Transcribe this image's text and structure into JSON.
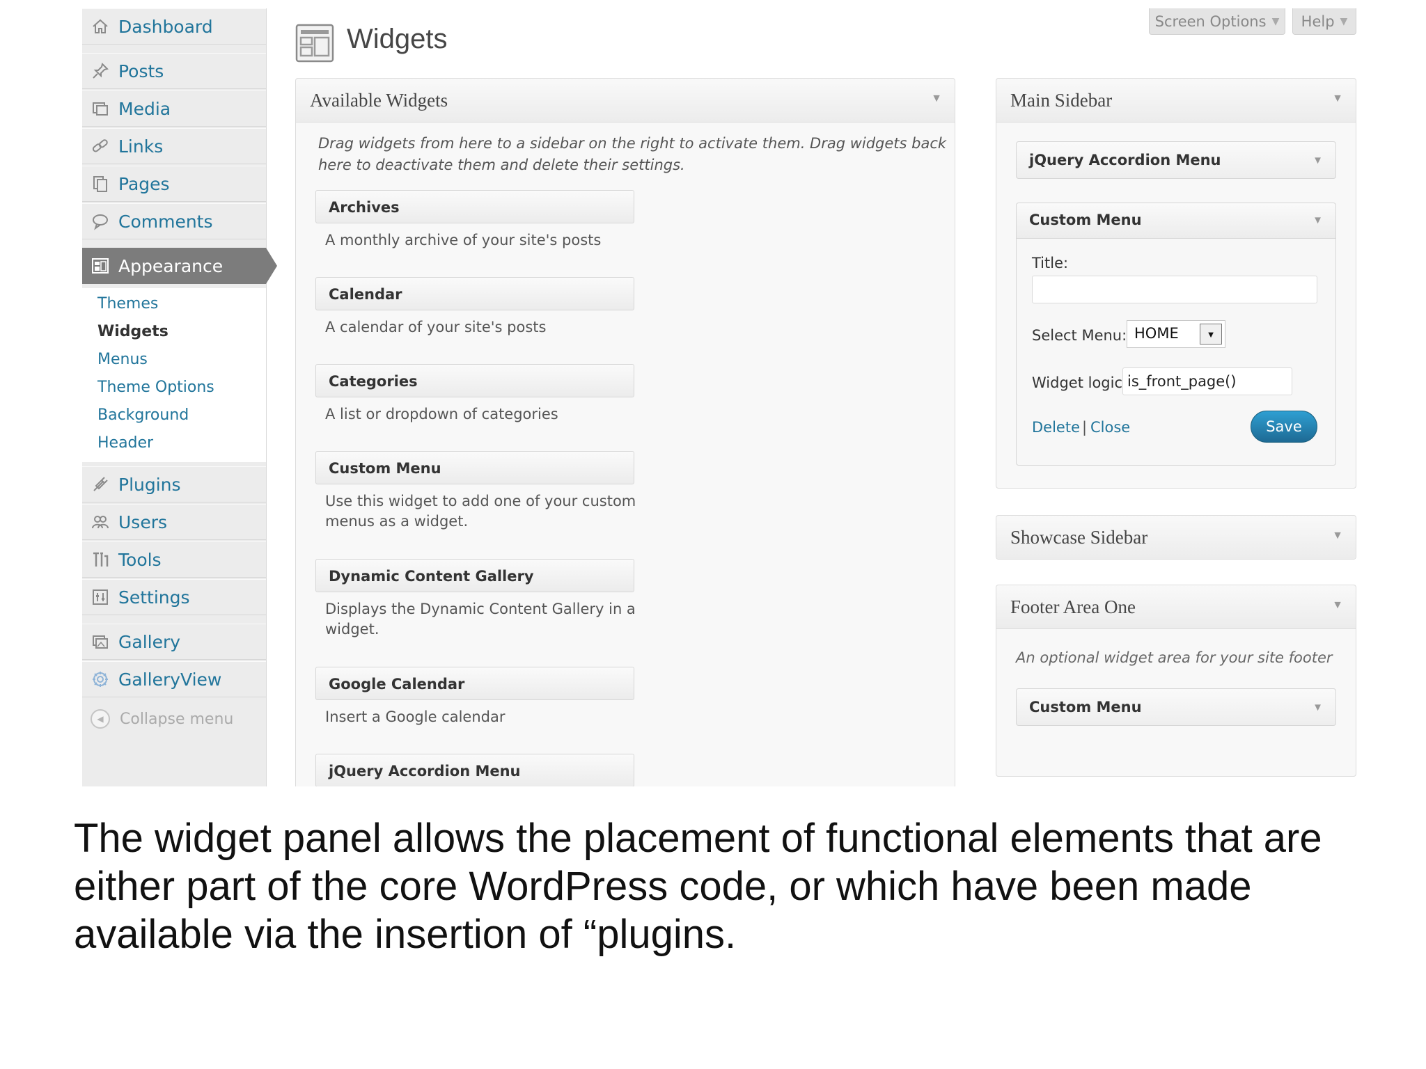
{
  "admin_menu": {
    "items": [
      {
        "label": "Dashboard",
        "icon": "home-icon"
      },
      {
        "label": "Posts",
        "icon": "pin-icon"
      },
      {
        "label": "Media",
        "icon": "media-icon"
      },
      {
        "label": "Links",
        "icon": "link-icon"
      },
      {
        "label": "Pages",
        "icon": "pages-icon"
      },
      {
        "label": "Comments",
        "icon": "comment-icon"
      },
      {
        "label": "Appearance",
        "icon": "appearance-icon"
      },
      {
        "label": "Plugins",
        "icon": "plug-icon"
      },
      {
        "label": "Users",
        "icon": "users-icon"
      },
      {
        "label": "Tools",
        "icon": "tools-icon"
      },
      {
        "label": "Settings",
        "icon": "settings-icon"
      },
      {
        "label": "Gallery",
        "icon": "gallery-icon"
      },
      {
        "label": "GalleryView",
        "icon": "galleryview-icon"
      }
    ],
    "submenu": [
      "Themes",
      "Widgets",
      "Menus",
      "Theme Options",
      "Background",
      "Header"
    ],
    "collapse_label": "Collapse menu"
  },
  "header": {
    "title": "Widgets",
    "screen_options": "Screen Options",
    "help": "Help"
  },
  "available_widgets": {
    "title": "Available Widgets",
    "description": "Drag widgets from here to a sidebar on the right to activate them. Drag widgets back here to deactivate them and delete their settings.",
    "widgets": [
      {
        "name": "Archives",
        "desc": "A monthly archive of your site's posts"
      },
      {
        "name": "Calendar",
        "desc": "A calendar of your site's posts"
      },
      {
        "name": "Categories",
        "desc": "A list or dropdown of categories"
      },
      {
        "name": "Custom Menu",
        "desc": "Use this widget to add one of your custom menus as a widget."
      },
      {
        "name": "Dynamic Content Gallery",
        "desc": "Displays the Dynamic Content Gallery in a widget."
      },
      {
        "name": "Google Calendar",
        "desc": "Insert a Google calendar"
      },
      {
        "name": "jQuery Accordion Menu",
        "desc": ""
      }
    ]
  },
  "main_sidebar": {
    "title": "Main Sidebar",
    "widget1": "jQuery Accordion Menu",
    "custom_menu": {
      "title": "Custom Menu",
      "title_label": "Title:",
      "title_value": "",
      "select_label": "Select Menu:",
      "select_value": "HOME",
      "logic_label": "Widget logic",
      "logic_value": "is_front_page()",
      "delete": "Delete",
      "separator": "|",
      "close": "Close",
      "save": "Save"
    }
  },
  "showcase_sidebar": {
    "title": "Showcase Sidebar"
  },
  "footer_area": {
    "title": "Footer Area One",
    "description": "An optional widget area for your site footer",
    "widget": "Custom Menu"
  },
  "caption": "The widget panel allows the placement of functional elements that are either part of the core WordPress code, or which have been made available via the insertion of “plugins."
}
